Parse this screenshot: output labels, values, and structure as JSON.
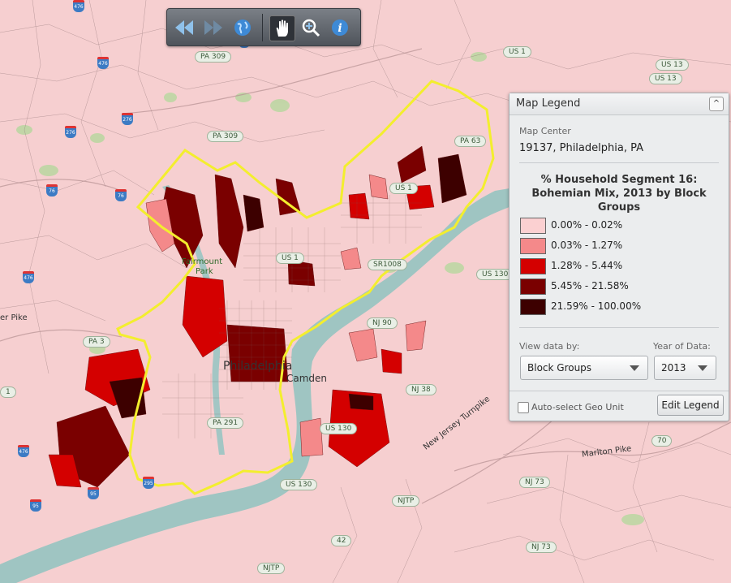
{
  "map": {
    "labels": {
      "us13_a": "US 13",
      "us1_a": "US 1",
      "us13_b": "US 13",
      "pa309_a": "PA 309",
      "pa309_b": "PA 309",
      "pa63": "PA 63",
      "us1_b": "US 1",
      "us1_c": "US 1",
      "sr1008": "SR1008",
      "us130_a": "US 130",
      "nj90": "NJ 90",
      "pa3": "PA 3",
      "nj38": "NJ 38",
      "us130_b": "US 130",
      "pa291": "PA 291",
      "us130_c": "US 130",
      "nj73_a": "NJ 73",
      "njtp_a": "NJTP",
      "njtp_b": "NJTP",
      "r42": "42",
      "nj73_b": "NJ 73",
      "r70": "70",
      "i476_a": "476",
      "i476_b": "476",
      "i276_a": "276",
      "i276_b": "276",
      "i276_c": "276",
      "i76_a": "76",
      "i76_b": "76",
      "i476_c": "476",
      "i476_d": "476",
      "i95_a": "95",
      "i95_b": "95",
      "i295": "295",
      "i1": "1",
      "philadelphia": "Philadelphia",
      "camden": "Camden",
      "fairmount": "Fairmount",
      "park": "Park",
      "pike": "er Pike",
      "marlton": "Marlton Pike",
      "njturnpike": "New Jersey Turnpike"
    }
  },
  "toolbar": {
    "icons": [
      "rewind-icon",
      "forward-icon",
      "globe-icon",
      "hand-icon",
      "zoom-icon",
      "info-icon"
    ]
  },
  "legend": {
    "title": "Map Legend",
    "collapse": "^",
    "center_label": "Map Center",
    "center_value": "19137, Philadelphia, PA",
    "layer_title": "% Household Segment 16: Bohemian Mix, 2013 by Block Groups",
    "classes": [
      {
        "label": "0.00% - 0.02%",
        "color": "#fbd0d1"
      },
      {
        "label": "0.03% - 1.27%",
        "color": "#f4898a"
      },
      {
        "label": "1.28% - 5.44%",
        "color": "#d40000"
      },
      {
        "label": "5.45% - 21.58%",
        "color": "#7a0000"
      },
      {
        "label": "21.59% - 100.00%",
        "color": "#3d0000"
      }
    ],
    "view_by_label": "View data by:",
    "view_by_value": "Block Groups",
    "year_label": "Year of Data:",
    "year_value": "2013",
    "autoselect_label": "Auto-select Geo Unit",
    "edit_button": "Edit Legend"
  }
}
